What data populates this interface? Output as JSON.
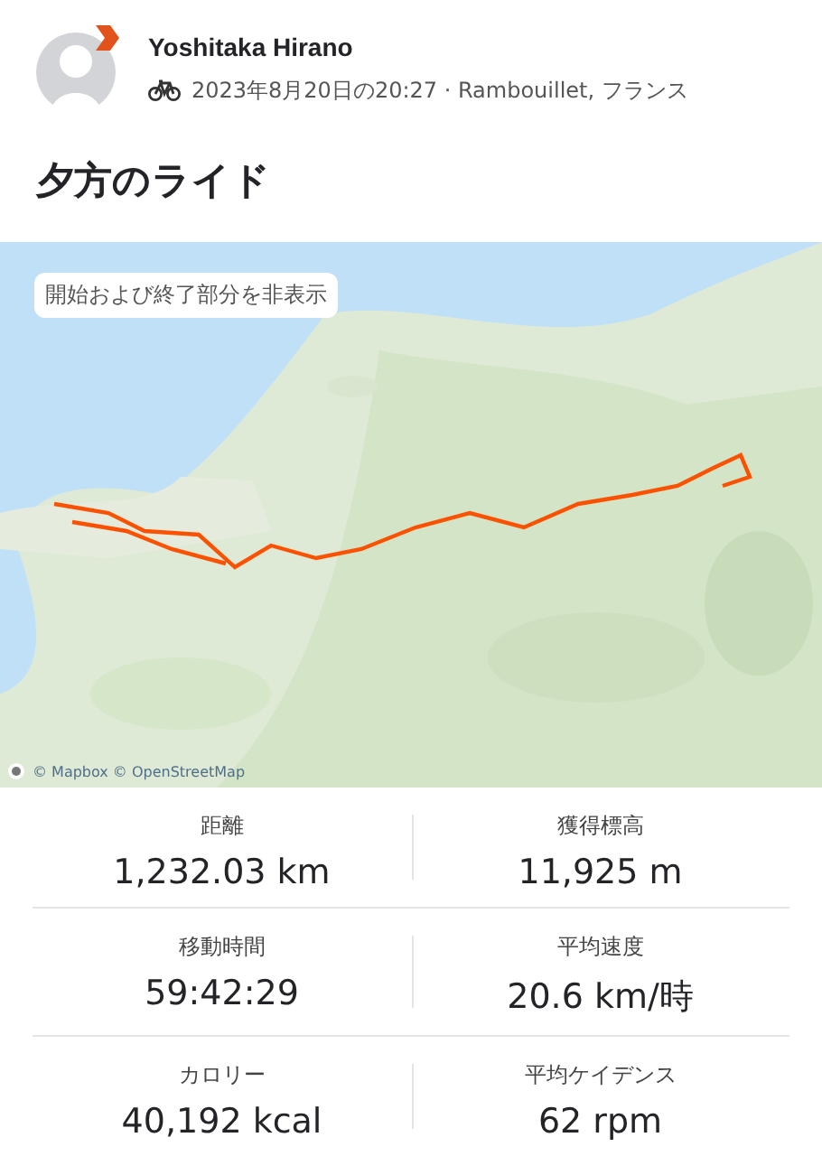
{
  "athlete": {
    "name": "Yoshitaka Hirano",
    "kind": "ride",
    "meta": "2023年8月20日の20:27 · Rambouillet, フランス"
  },
  "title": "夕方のライド",
  "map": {
    "kind": "picture",
    "toggle_button": "開始および終了部分を非表示",
    "attribution": "© Mapbox © OpenStreetMap"
  },
  "stats": [
    {
      "label": "距離",
      "value": "1,232.03 km"
    },
    {
      "label": "獲得標高",
      "value": "11,925 m"
    },
    {
      "label": "移動時間",
      "value": "59:42:29"
    },
    {
      "label": "平均速度",
      "value": "20.6 km/時"
    },
    {
      "label": "カロリー",
      "value": "40,192 kcal"
    },
    {
      "label": "平均ケイデンス",
      "value": "62 rpm"
    }
  ]
}
